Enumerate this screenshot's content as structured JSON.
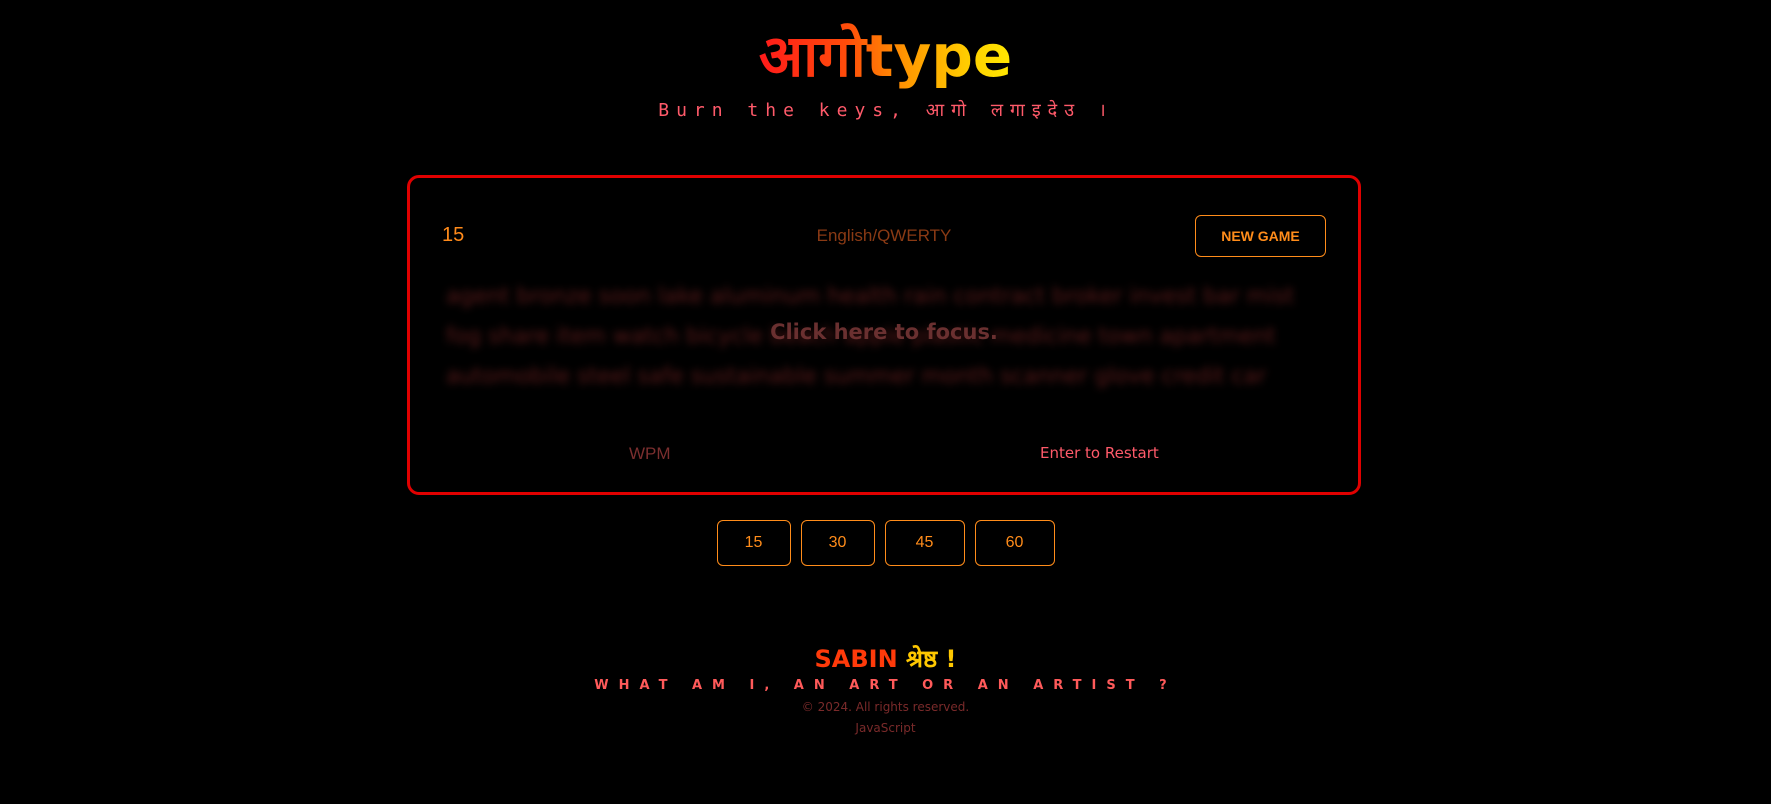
{
  "header": {
    "logo": "आगोtype",
    "tagline": "Burn the keys, आगो लगाइदेउ ।"
  },
  "game": {
    "timer": "15",
    "layout": "English/QWERTY",
    "new_game_label": "NEW GAME",
    "words": "agent bronze soon lake aluminum health rain contract broker invest bar mist fog share item watch bicycle beach apple plastic medicine town apartment automobile steel safe sustainable summer month scanner glove credit car sleet",
    "focus_prompt": "Click here to focus.",
    "wpm_label": "WPM",
    "restart_hint": "Enter to Restart"
  },
  "durations": [
    "15",
    "30",
    "45",
    "60"
  ],
  "footer": {
    "author_first": "SABIN",
    "author_last": "श्रेष्ठ !",
    "motto": "WHAT AM I, AN ART OR AN ARTIST ?",
    "copyright": "© 2024. All rights reserved.",
    "tech": "JavaScript"
  },
  "colors": {
    "accent": "#ff8c1a",
    "border": "#e00000",
    "tagline": "#ff5a6a"
  }
}
